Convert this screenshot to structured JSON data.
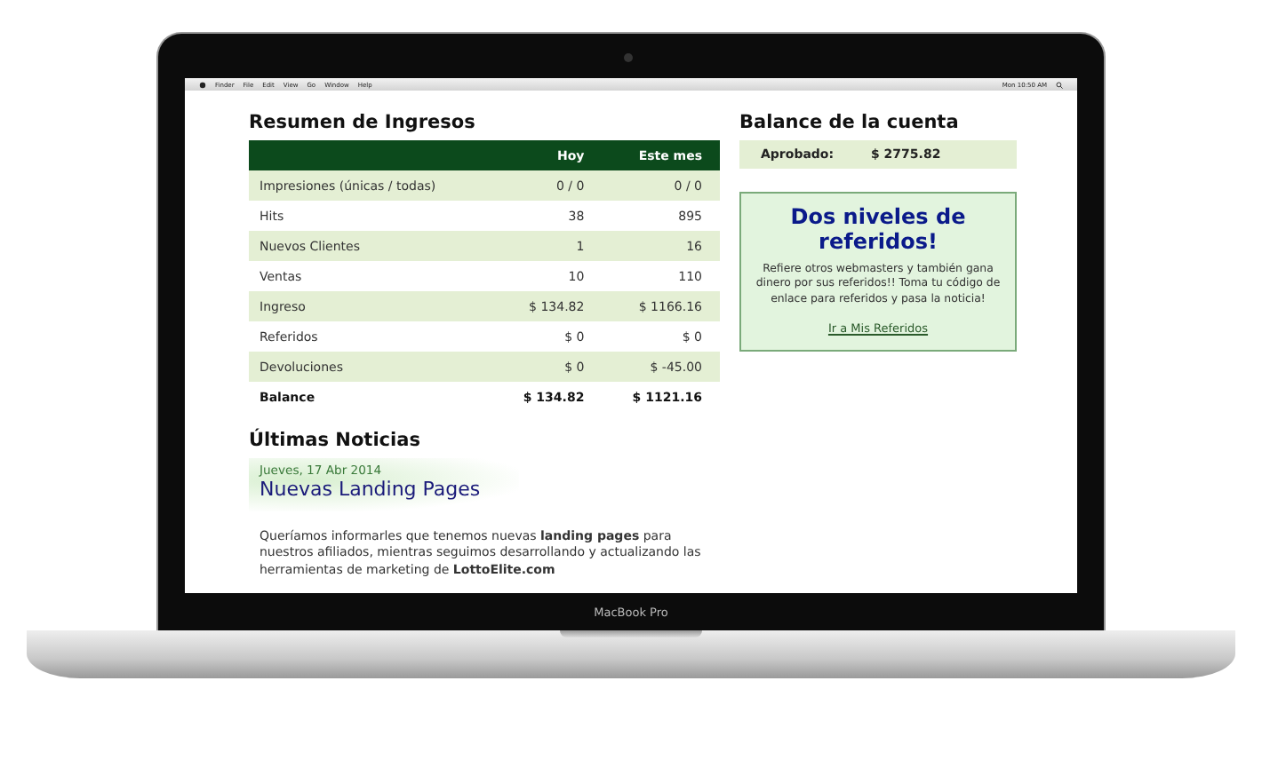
{
  "menu_bar": {
    "items": [
      "Finder",
      "File",
      "Edit",
      "View",
      "Go",
      "Window",
      "Help"
    ],
    "clock": "Mon 10:50 AM"
  },
  "income_summary": {
    "title": "Resumen de Ingresos",
    "columns": [
      "Hoy",
      "Este mes"
    ],
    "rows": [
      {
        "label": "Impresiones (únicas / todas)",
        "today": "0 / 0",
        "month": "0 / 0",
        "kind": "data"
      },
      {
        "label": "Hits",
        "today": "38",
        "month": "895",
        "kind": "data"
      },
      {
        "label": "Nuevos Clientes",
        "today": "1",
        "month": "16",
        "kind": "data"
      },
      {
        "label": "Ventas",
        "today": "10",
        "month": "110",
        "kind": "data"
      },
      {
        "label": "Ingreso",
        "today": "$ 134.82",
        "month": "$ 1166.16",
        "kind": "data"
      },
      {
        "label": "Referidos",
        "today": "$ 0",
        "month": "$ 0",
        "kind": "data"
      },
      {
        "label": "Devoluciones",
        "today": "$ 0",
        "month": "$ -45.00",
        "kind": "data"
      },
      {
        "label": "Balance",
        "today": "$ 134.82",
        "month": "$ 1121.16",
        "kind": "total"
      }
    ]
  },
  "account_balance": {
    "title": "Balance de la cuenta",
    "label": "Aprobado:",
    "amount": "$ 2775.82"
  },
  "promo": {
    "title": "Dos niveles de referidos!",
    "text": "Refiere otros webmasters y también gana dinero por sus referidos!! Toma tu código de enlace para referidos y pasa la noticia!",
    "link": "Ir a Mis Referidos"
  },
  "news": {
    "title": "Últimas Noticias",
    "items": [
      {
        "date": "Jueves, 17 Abr 2014",
        "headline": "Nuevas Landing Pages",
        "body": "Queríamos informarles que tenemos nuevas **landing pages** para nuestros afiliados, mientras seguimos desarrollando y actualizando las herramientas de marketing de **LottoElite.com**"
      }
    ]
  },
  "device_label": "MacBook Pro"
}
